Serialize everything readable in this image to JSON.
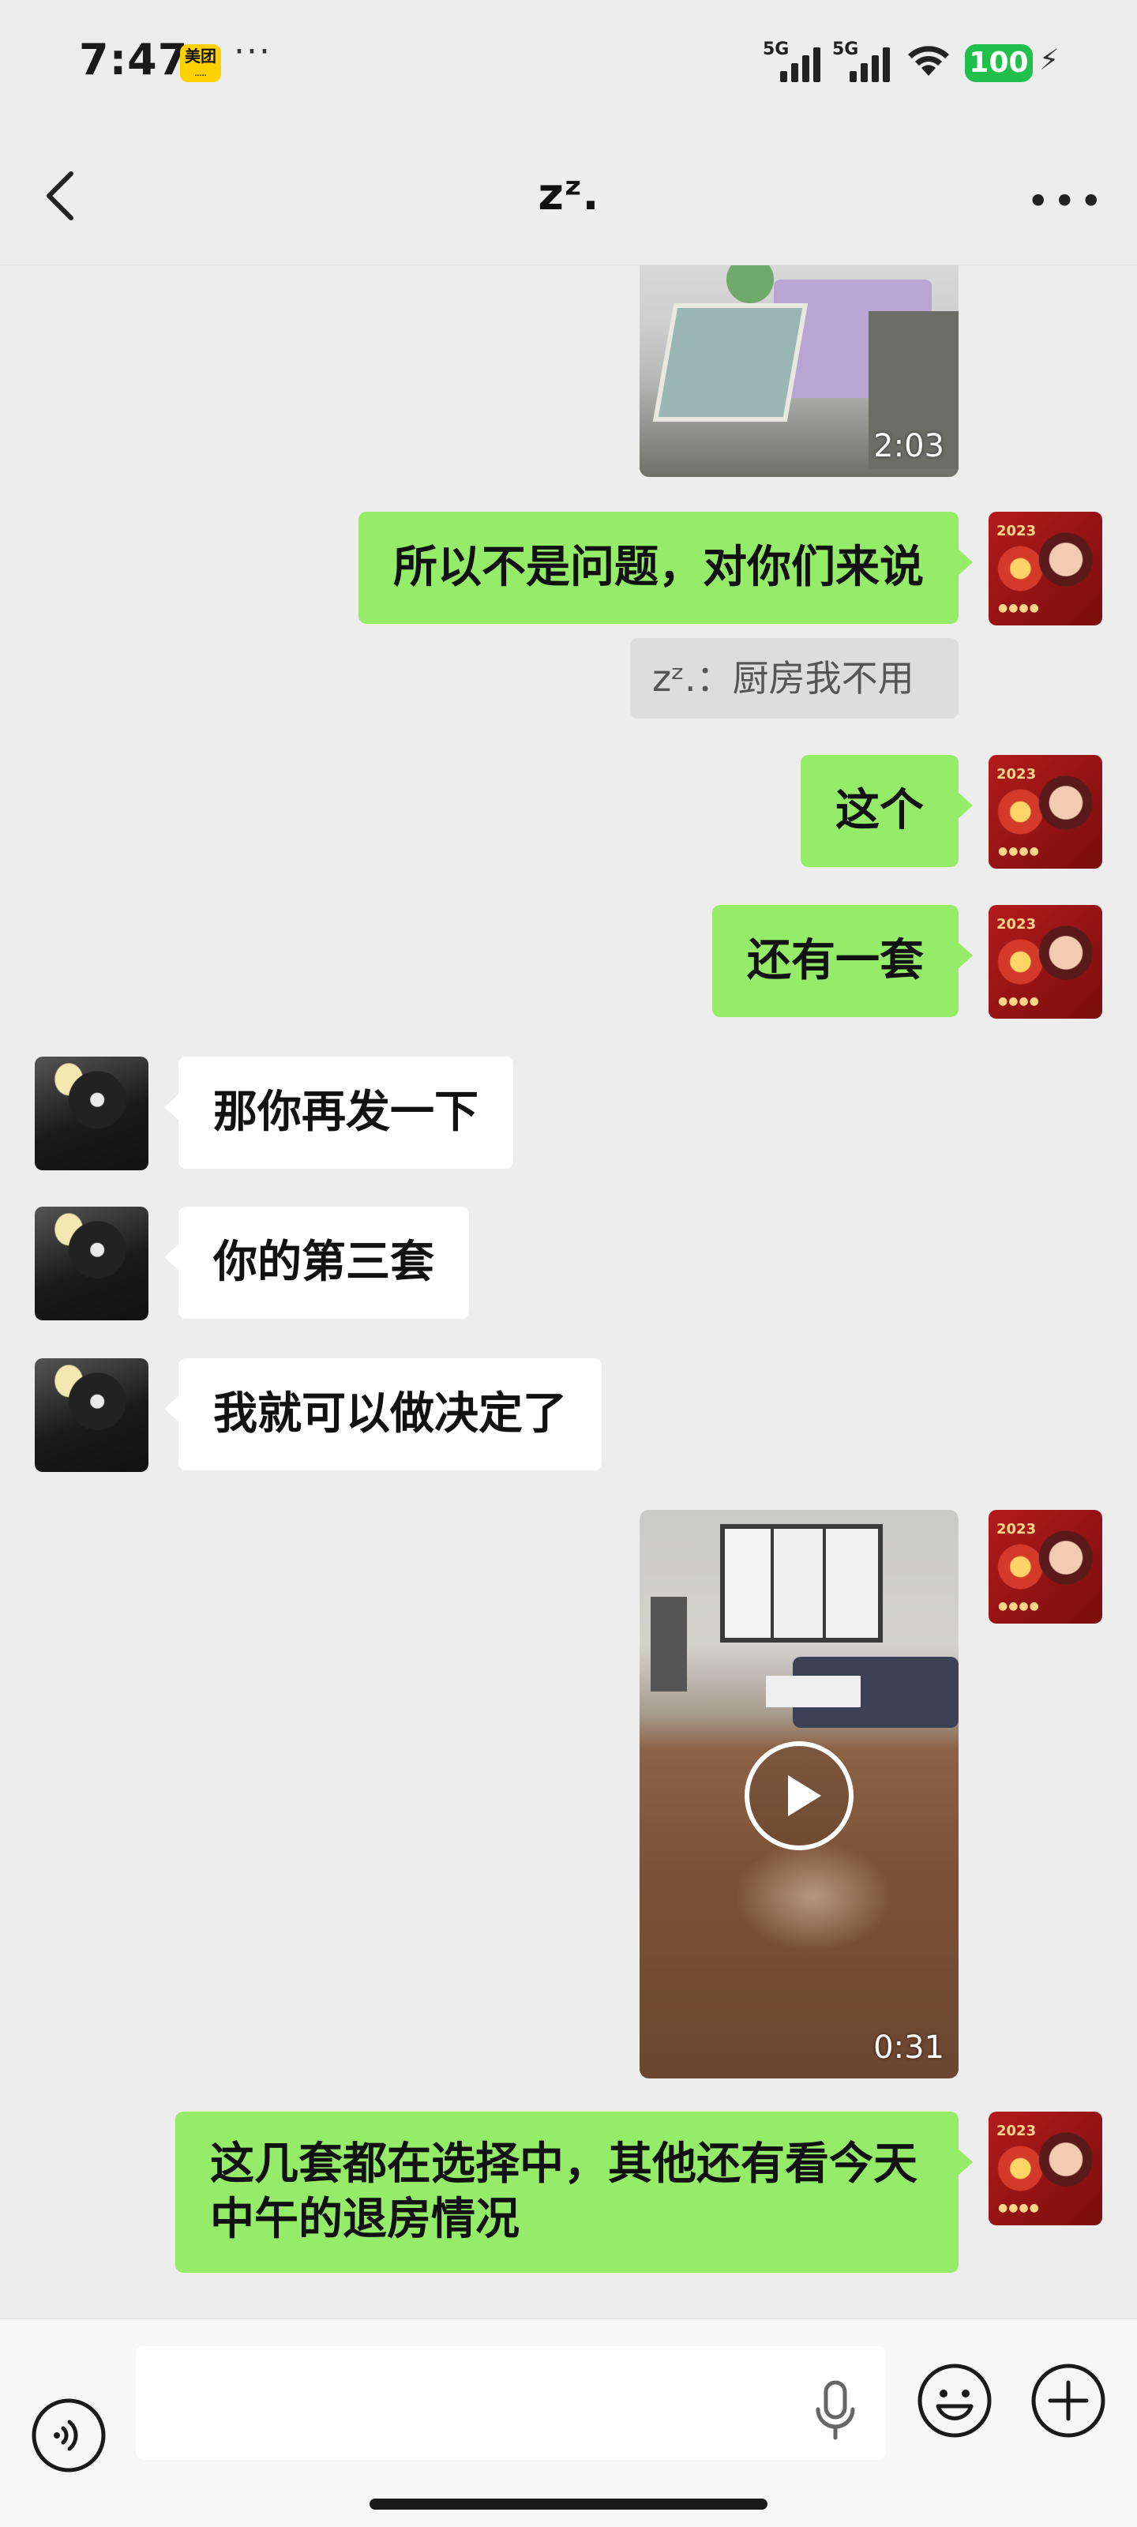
{
  "status_bar": {
    "time": "7:47",
    "meituan_badge": "美团",
    "more": "···",
    "signal_1": "5G",
    "signal_2": "5G",
    "battery": "100"
  },
  "header": {
    "title": "zᶻ."
  },
  "messages": [
    {
      "side": "self",
      "type": "video",
      "duration": "2:03"
    },
    {
      "side": "self",
      "type": "text",
      "text": "所以不是问题，对你们来说"
    },
    {
      "side": "self",
      "type": "quote",
      "text": "zᶻ.：厨房我不用"
    },
    {
      "side": "self",
      "type": "text",
      "text": "这个"
    },
    {
      "side": "self",
      "type": "text",
      "text": "还有一套"
    },
    {
      "side": "other",
      "type": "text",
      "text": "那你再发一下"
    },
    {
      "side": "other",
      "type": "text",
      "text": "你的第三套"
    },
    {
      "side": "other",
      "type": "text",
      "text": "我就可以做决定了"
    },
    {
      "side": "self",
      "type": "video",
      "duration": "0:31"
    },
    {
      "side": "self",
      "type": "text",
      "text": "这几套都在选择中，其他还有看今天中午的退房情况"
    }
  ],
  "self_avatar": {
    "year": "2023"
  },
  "input_bar": {
    "placeholder": ""
  },
  "colors": {
    "background": "#ededed",
    "self_bubble": "#95ec69",
    "other_bubble": "#ffffff",
    "battery": "#21c04b"
  }
}
